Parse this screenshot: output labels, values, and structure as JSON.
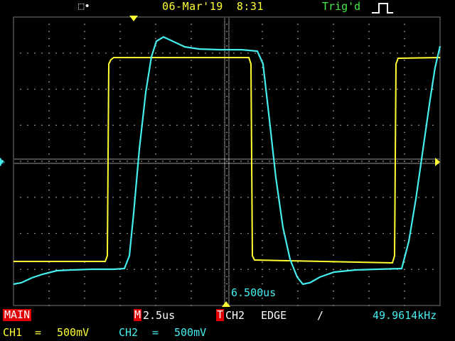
{
  "status_bar": {
    "usb_icon": "usb-connection-icon",
    "date": "06-Mar'19",
    "time": "8:31",
    "trig_status": "Trig'd"
  },
  "display": {
    "trigger_position_readout": "6.500us",
    "ch2_trace_visible": true,
    "ch1_trace_visible": true
  },
  "bottom": {
    "menu_label": "MAIN",
    "m_badge": "M",
    "timebase": "2.5us",
    "t_badge": "T",
    "trig_source": "CH2",
    "trig_type": "EDGE",
    "slope_symbol": "/",
    "frequency": "49.9614kHz",
    "ch1_label": "CH1",
    "ch1_coupling": "=",
    "ch1_scale": "500mV",
    "ch2_label": "CH2",
    "ch2_coupling": "=",
    "ch2_scale": "500mV"
  },
  "colors": {
    "ch1": "#ffff33",
    "ch2": "#44eeee",
    "grid": "#cccccc",
    "badge_red": "#e00000",
    "trig_green": "#44ee44"
  }
}
